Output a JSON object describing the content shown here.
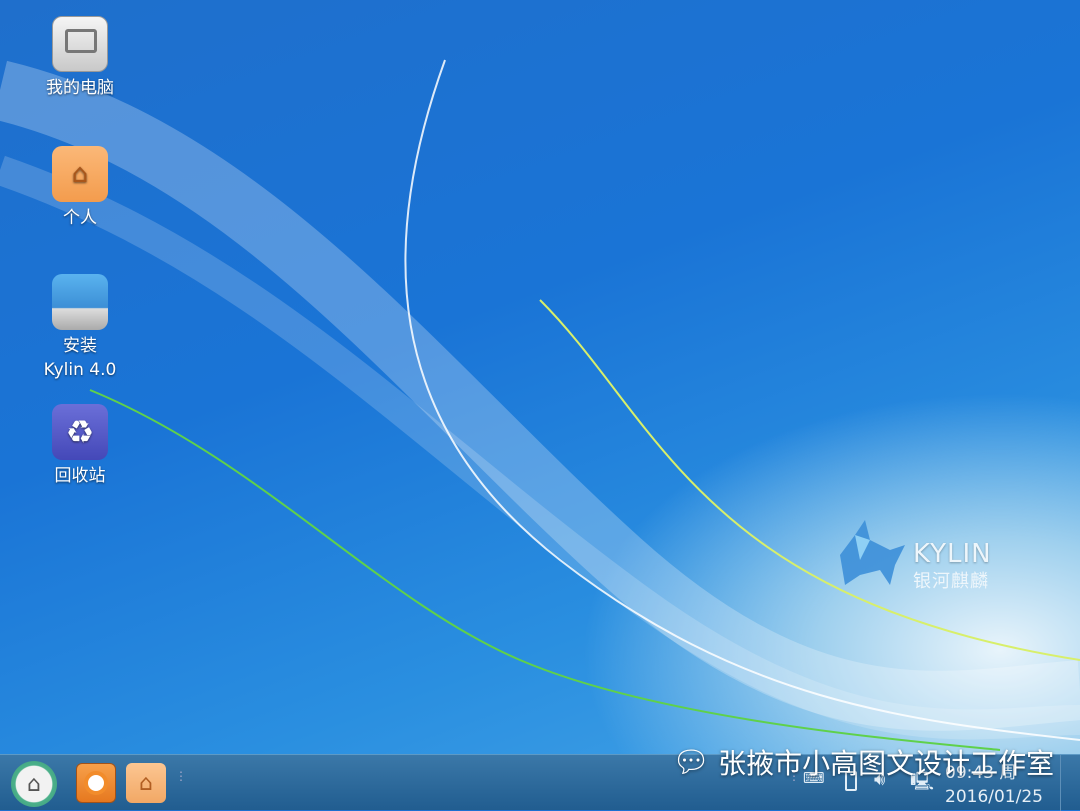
{
  "desktop": {
    "icons": [
      {
        "label": "我的电脑",
        "icon": "computer-icon"
      },
      {
        "label": "个人",
        "icon": "home-folder-icon"
      },
      {
        "label": "安装",
        "label2": "Kylin 4.0",
        "icon": "installer-icon"
      },
      {
        "label": "回收站",
        "icon": "trash-icon"
      }
    ]
  },
  "logo": {
    "name": "KYLIN",
    "subtitle": "银河麒麟"
  },
  "taskbar": {
    "clock_time": "09:43 周",
    "clock_date": "2016/01/25"
  },
  "watermark": {
    "text": "张掖市小高图文设计工作室"
  }
}
